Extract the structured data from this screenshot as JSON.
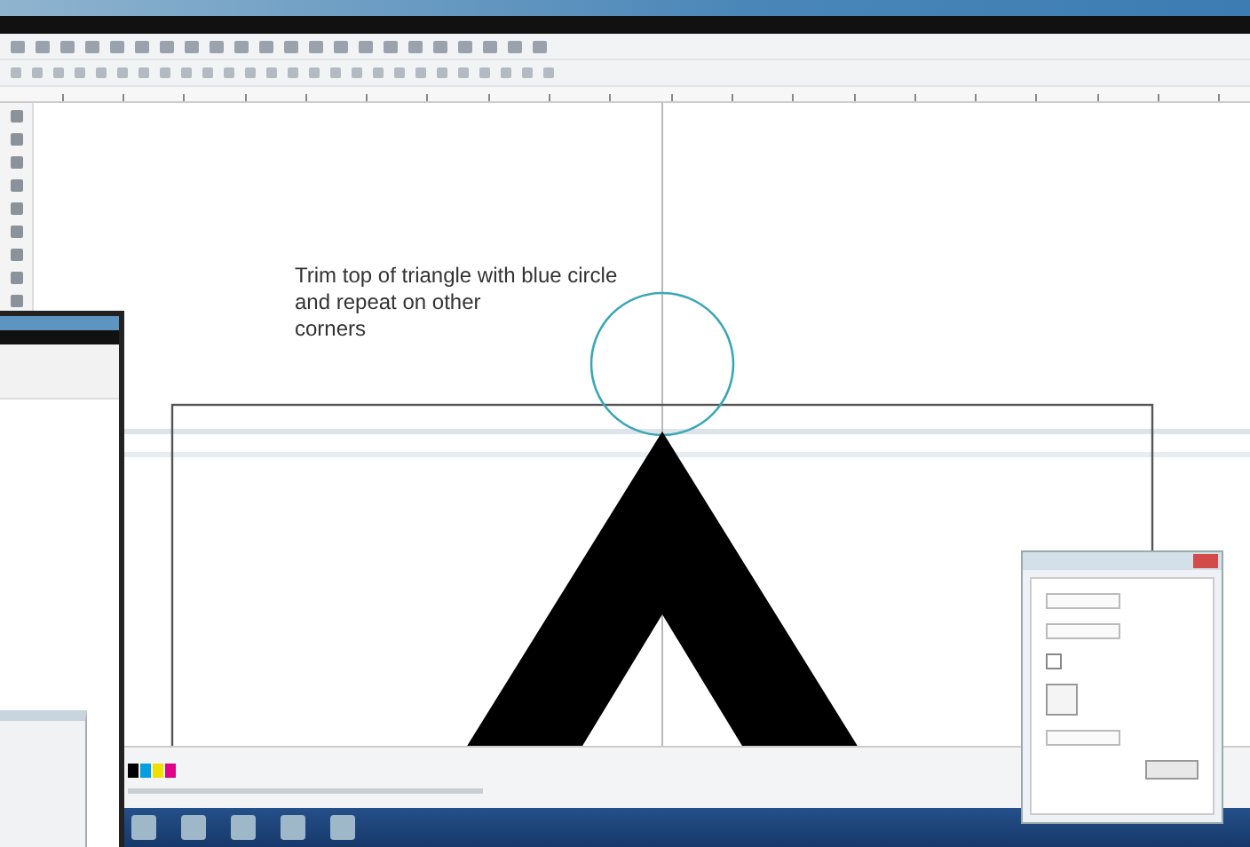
{
  "annotation": {
    "lines": [
      "Trim top of triangle with blue circle",
      "and repeat on other",
      "corners"
    ]
  },
  "docker": {
    "checked": false
  },
  "palette": [
    {
      "color": "#000000"
    },
    {
      "color": "#00a0e0"
    },
    {
      "color": "#f0e000"
    },
    {
      "color": "#e0008a"
    }
  ]
}
